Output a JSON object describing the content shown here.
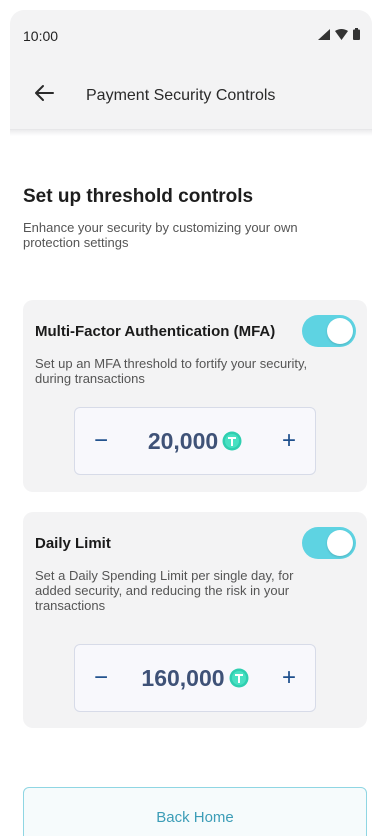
{
  "status_bar": {
    "time": "10:00",
    "icons": [
      "signal-icon",
      "wifi-icon",
      "battery-icon"
    ]
  },
  "header": {
    "title": "Payment Security Controls",
    "back_icon": "arrow-left-icon"
  },
  "intro": {
    "title": "Set up threshold controls",
    "subtitle": "Enhance your security by customizing your own protection settings"
  },
  "mfa": {
    "title": "Multi-Factor Authentication (MFA)",
    "description": "Set up an MFA threshold to fortify your security,  during transactions",
    "enabled": true,
    "amount": "20,000",
    "minus_label": "−",
    "plus_label": "+"
  },
  "daily_limit": {
    "title": "Daily Limit",
    "description": "Set a Daily Spending Limit per single day, for added security, and reducing the risk in your transactions",
    "enabled": true,
    "amount": "160,000",
    "minus_label": "−",
    "plus_label": "+"
  },
  "footer": {
    "back_home_label": "Back Home"
  },
  "colors": {
    "accent": "#5ed3e2",
    "stepper_text": "#3f5277",
    "button_text": "#3c9db7"
  }
}
